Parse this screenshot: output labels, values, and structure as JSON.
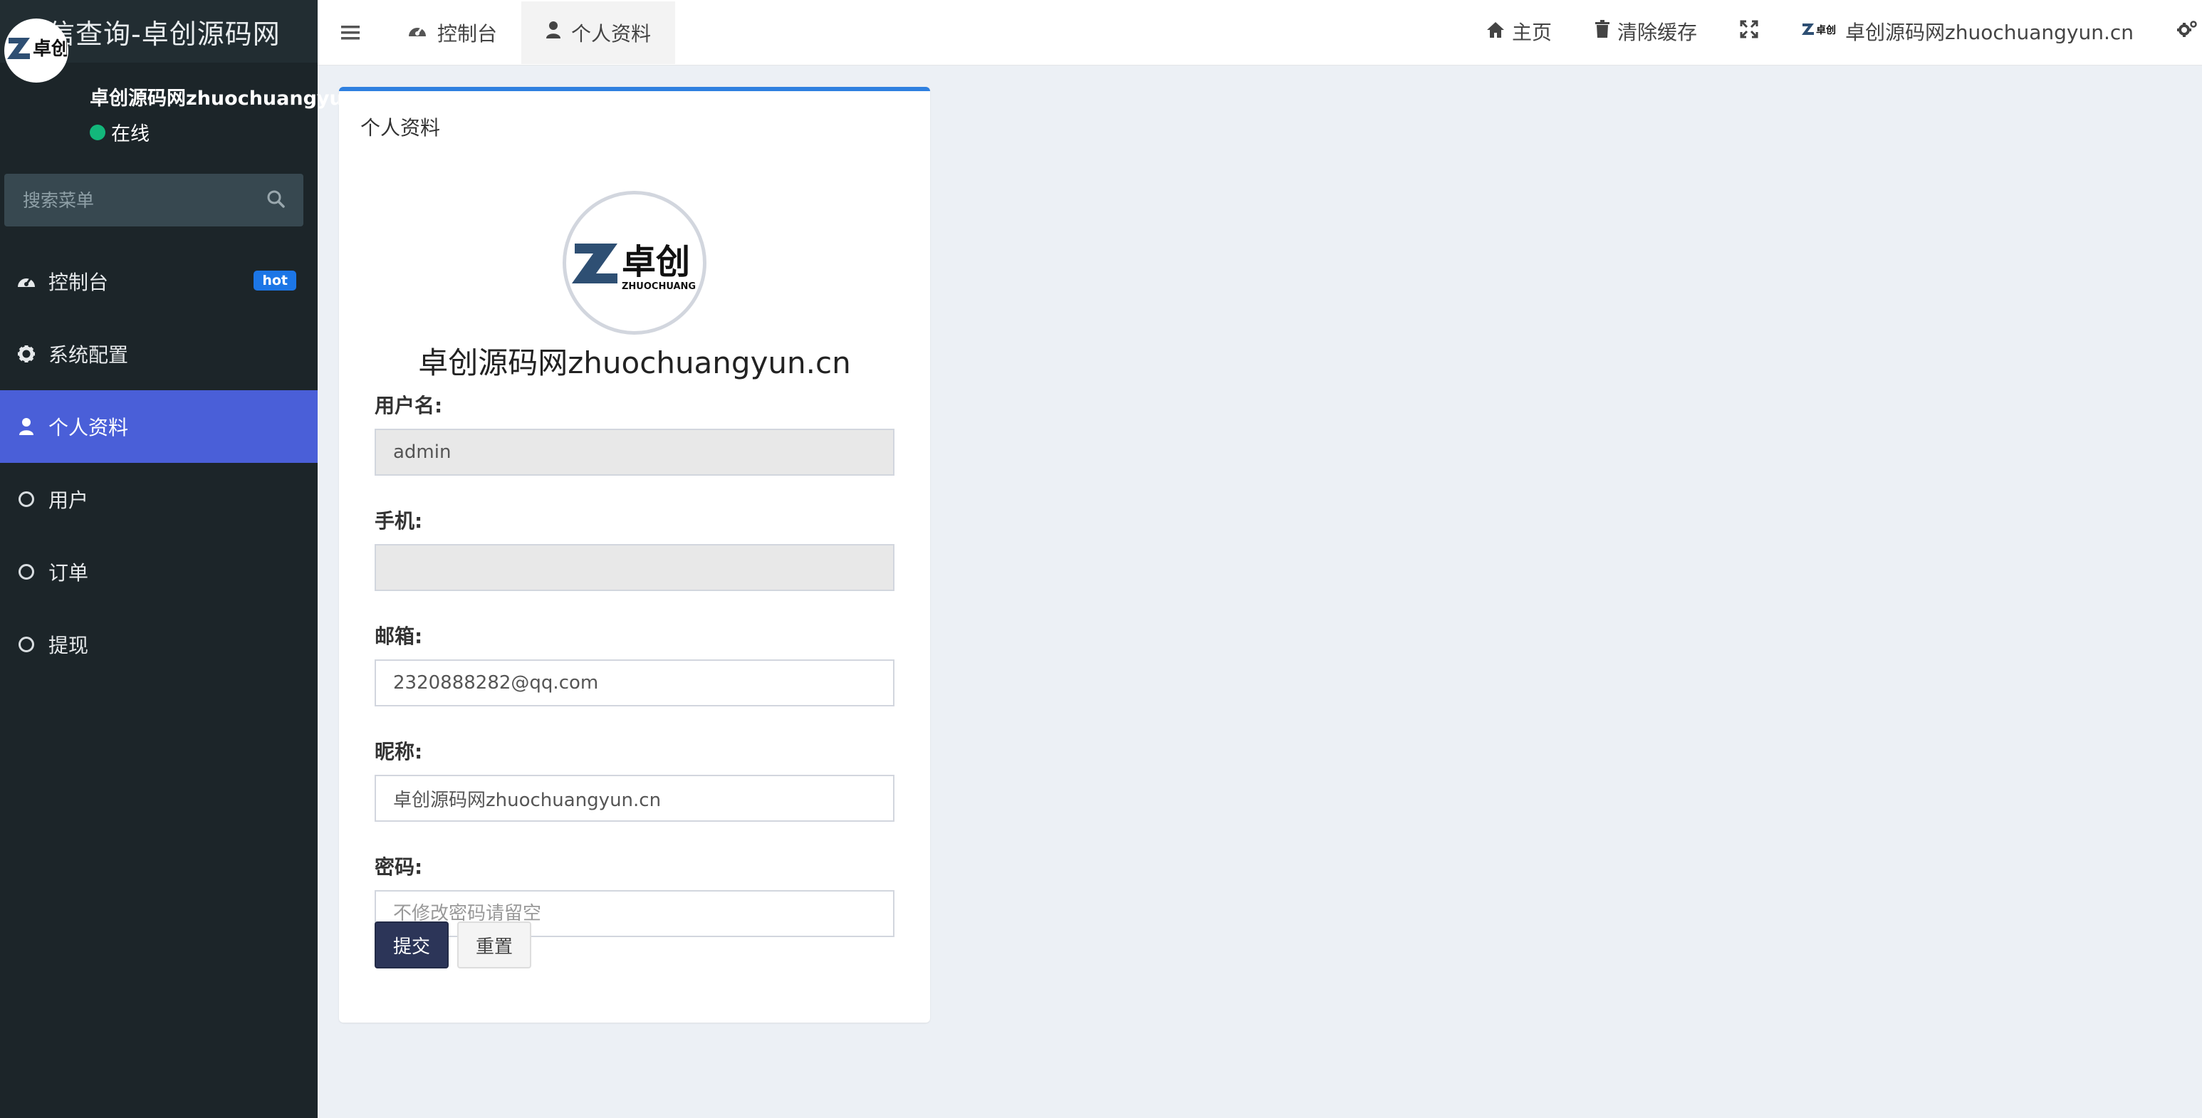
{
  "app": {
    "title": "征信查询-卓创源码网"
  },
  "user": {
    "name": "卓创源码网zhuochuangyun.cn",
    "status": "在线",
    "logo_text": "卓创",
    "logo_sub": "ZHUOCHUANG"
  },
  "search": {
    "placeholder": "搜索菜单"
  },
  "sidebar": {
    "items": [
      {
        "label": "控制台",
        "icon": "dashboard-icon",
        "badge": "hot"
      },
      {
        "label": "系统配置",
        "icon": "gear-icon"
      },
      {
        "label": "个人资料",
        "icon": "user-icon",
        "active": true
      },
      {
        "label": "用户",
        "icon": "circle-o-icon"
      },
      {
        "label": "订单",
        "icon": "circle-o-icon"
      },
      {
        "label": "提现",
        "icon": "circle-o-icon"
      }
    ]
  },
  "navbar": {
    "tabs": [
      {
        "label": "控制台",
        "icon": "dashboard-icon"
      },
      {
        "label": "个人资料",
        "icon": "user-icon",
        "active": true
      }
    ],
    "right": {
      "home": "主页",
      "clear_cache": "清除缓存",
      "user_name": "卓创源码网zhuochuangyun.cn"
    }
  },
  "profile": {
    "box_title": "个人资料",
    "name": "卓创源码网zhuochuangyun.cn",
    "fields": {
      "username": {
        "label": "用户名:",
        "value": "admin"
      },
      "phone": {
        "label": "手机:",
        "value": ""
      },
      "email": {
        "label": "邮箱:",
        "value": "2320888282@qq.com"
      },
      "nickname": {
        "label": "昵称:",
        "value": "卓创源码网zhuochuangyun.cn"
      },
      "password": {
        "label": "密码:",
        "value": "",
        "placeholder": "不修改密码请留空"
      }
    },
    "submit": "提交",
    "reset": "重置"
  },
  "colors": {
    "sidebar": "#1c2529",
    "active": "#4a5fd8",
    "accent": "#2f80e0",
    "online": "#13b77b",
    "badge": "#1c76e6"
  }
}
